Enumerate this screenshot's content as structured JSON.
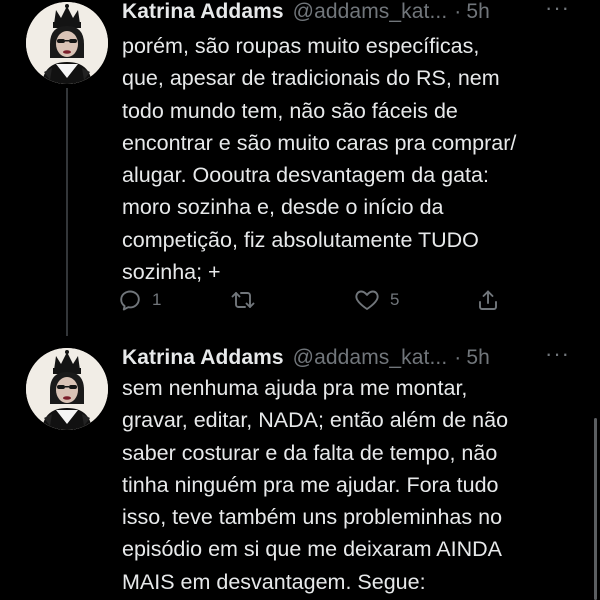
{
  "tweets": [
    {
      "author_name": "Katrina Addams",
      "handle": "@addams_kat...",
      "separator": "·",
      "time": "5h",
      "more": "···",
      "text": "porém, são roupas muito específicas,\nque, apesar de tradicionais do RS, nem\ntodo mundo tem, não são fáceis de\nencontrar e são muito caras pra comprar/\nalugar. Oooutra desvantagem da gata:\nmoro sozinha e, desde o início da\ncompetição, fiz absolutamente TUDO\nsozinha; +",
      "reply_count": "1",
      "retweet_count": "",
      "like_count": "5"
    },
    {
      "author_name": "Katrina Addams",
      "handle": "@addams_kat...",
      "separator": "·",
      "time": "5h",
      "more": "···",
      "text": "sem nenhuma ajuda pra me montar,\ngravar, editar, NADA; então além de não\nsaber costurar e da falta de tempo, não\ntinha ninguém pra me ajudar. Fora tudo\nisso, teve também uns probleminhas no\nepisódio em si que me deixaram AINDA\nMAIS em desvantagem. Segue:"
    }
  ],
  "icons": {
    "reply": "reply-icon",
    "retweet": "retweet-icon",
    "like": "heart-icon",
    "share": "share-icon"
  },
  "colors": {
    "background": "#000000",
    "text": "#e7e9ea",
    "secondary": "#71767b",
    "thread_line": "#333639"
  }
}
